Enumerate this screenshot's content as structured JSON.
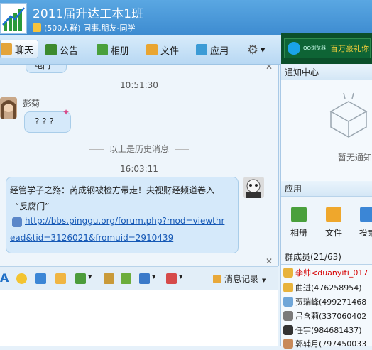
{
  "window": {
    "group_name": "2011届升达工本1班",
    "group_info": "(500人群) 同事.朋友-同学"
  },
  "toolbar": {
    "chat": "聊天",
    "notice": "公告",
    "album": "相册",
    "files": "文件",
    "apps": "应用"
  },
  "ad": {
    "small": "QQ浏览器",
    "text": "百万豪礼你"
  },
  "chat": {
    "top_bubble_text": "电门",
    "time1": "10:51:30",
    "sender1": "彭菊",
    "msg1": "? ? ?",
    "history_sep": "以上是历史消息",
    "time2": "16:03:11",
    "msg2_line1": "经管学子之殇：芮成钢被检方带走！央视财经频道卷入",
    "msg2_line2": "“反腐门”",
    "msg2_link_part1": "http://bbs.pinggu.org/forum.php?mod=viewthr",
    "msg2_link_part2": "ead&tid=3126021&fromuid=2910439"
  },
  "input_toolbar": {
    "history_label": "消息记录"
  },
  "right": {
    "notice_title": "通知中心",
    "notice_empty": "暂无通知",
    "apps_title": "应用",
    "apps": [
      "相册",
      "文件",
      "投票"
    ],
    "members_title": "群成员(21/63)",
    "members": [
      "李帅<duanyiti_017",
      "曲进(476258954)",
      "贾瑞峰(499271468",
      "吕含莉(337060402",
      "任宇(984681437)",
      "郭辅月(797450033"
    ]
  },
  "colors": {
    "header": "#3d8bd0",
    "bubble": "#d5e9fa",
    "link": "#1659b6",
    "member_highlight": "#d60000"
  }
}
